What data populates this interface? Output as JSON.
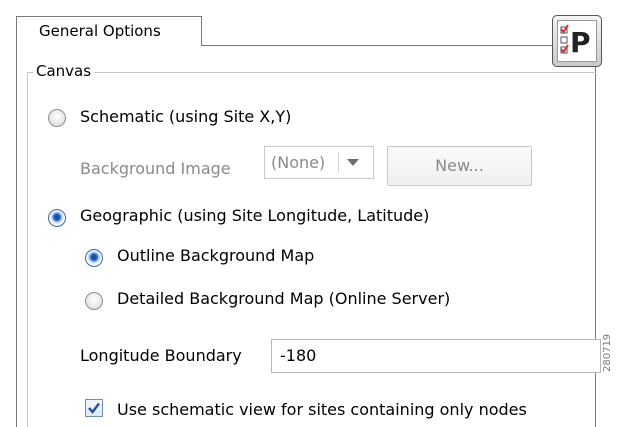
{
  "tab": {
    "label": "General Options"
  },
  "canvas": {
    "group_title": "Canvas",
    "schematic": {
      "label": "Schematic (using Site X,Y)",
      "checked": false
    },
    "background_image": {
      "label": "Background Image",
      "value": "(None)",
      "button_label": "New..."
    },
    "geographic": {
      "label": "Geographic (using Site Longitude, Latitude)",
      "checked": true
    },
    "outline_map": {
      "label": "Outline Background Map",
      "checked": true
    },
    "detailed_map": {
      "label": "Detailed Background Map (Online Server)",
      "checked": false
    },
    "longitude_boundary": {
      "label": "Longitude Boundary",
      "value": "-180"
    },
    "schematic_view_nodes": {
      "label": "Use schematic view for sites containing only nodes",
      "checked": true
    }
  },
  "logo": {
    "letter": "P"
  },
  "figure_id": "280719",
  "colors": {
    "radio_selected": "#1f56c4",
    "check_mark": "#1e4f9c",
    "disabled_text": "#8a8a8a"
  }
}
